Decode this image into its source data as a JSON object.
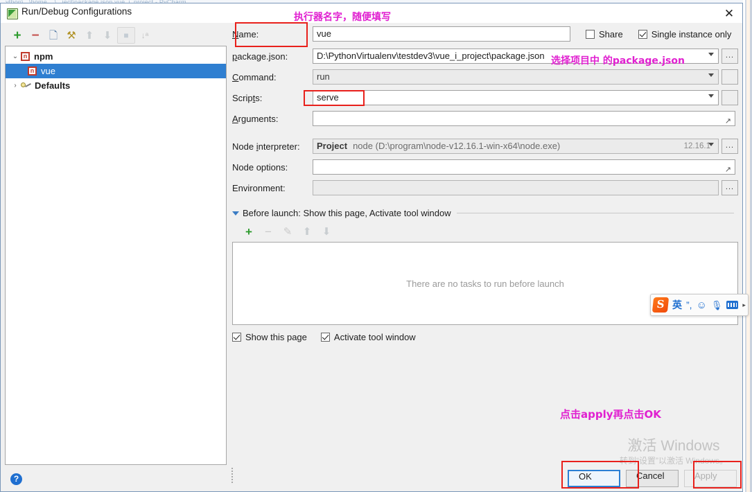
{
  "behind": {
    "top_strip_text": "...ython\\...\\home  ...\\...ject\\package.json  vue_i_project - PyCharm"
  },
  "window": {
    "title": "Run/Debug Configurations",
    "icon": "pycharm-run-config-icon",
    "close_label": "✕"
  },
  "tree_toolbar": [
    {
      "name": "add-configuration-button",
      "glyph": "+",
      "enabled": true
    },
    {
      "name": "remove-configuration-button",
      "glyph": "−",
      "enabled": true
    },
    {
      "name": "copy-configuration-button",
      "glyph": "❐",
      "enabled": true
    },
    {
      "name": "edit-templates-button",
      "glyph": "⚒",
      "enabled": true
    },
    {
      "name": "move-up-button",
      "glyph": "↑",
      "enabled": false
    },
    {
      "name": "move-down-button",
      "glyph": "↓",
      "enabled": false
    },
    {
      "name": "move-into-folder-button",
      "glyph": "■",
      "enabled": false
    },
    {
      "name": "sort-configurations-button",
      "glyph": "↓ᵃ",
      "enabled": false
    }
  ],
  "tree": [
    {
      "name": "tree-node-npm",
      "label": "npm",
      "twisty": "⌄",
      "icon": "npm-icon",
      "icon_text": "n",
      "selected": false,
      "indent": 0
    },
    {
      "name": "tree-node-vue",
      "label": "vue",
      "twisty": "",
      "icon": "npm-icon",
      "icon_text": "n",
      "selected": true,
      "indent": 1
    },
    {
      "name": "tree-node-defaults",
      "label": "Defaults",
      "twisty": "›",
      "icon": "defaults-icon",
      "icon_text": "",
      "selected": false,
      "indent": 0
    }
  ],
  "form": {
    "name_label": "Name:",
    "name_value": "vue",
    "share_label": "Share",
    "share_checked": false,
    "single_instance_label": "Single instance only",
    "single_instance_checked": true,
    "package_json_label": "package.json:",
    "package_json_value": "D:\\PythonVirtualenv\\testdev3\\vue_i_project\\package.json",
    "command_label": "Command:",
    "command_value": "run",
    "scripts_label": "Scripts:",
    "scripts_value": "serve",
    "arguments_label": "Arguments:",
    "arguments_value": "",
    "node_interpreter_label": "Node interpreter:",
    "node_interpreter_scope": "Project",
    "node_interpreter_path": "node (D:\\program\\node-v12.16.1-win-x64\\node.exe)",
    "node_interpreter_version": "12.16.1",
    "node_options_label": "Node options:",
    "node_options_value": "",
    "environment_label": "Environment:",
    "environment_value": "",
    "browse_glyph": "..."
  },
  "before_launch": {
    "header": "Before launch: Show this page, Activate tool window",
    "toolbar": [
      {
        "name": "add-task-button",
        "glyph": "+",
        "enabled": true
      },
      {
        "name": "remove-task-button",
        "glyph": "−",
        "enabled": false
      },
      {
        "name": "edit-task-button",
        "glyph": "✎",
        "enabled": false
      },
      {
        "name": "move-task-up-button",
        "glyph": "↑",
        "enabled": false
      },
      {
        "name": "move-task-down-button",
        "glyph": "↓",
        "enabled": false
      }
    ],
    "empty_text": "There are no tasks to run before launch",
    "show_this_page_label": "Show this page",
    "show_this_page_checked": true,
    "activate_tool_window_label": "Activate tool window",
    "activate_tool_window_checked": true
  },
  "footer": {
    "help_glyph": "?",
    "ok_label": "OK",
    "cancel_label": "Cancel",
    "apply_label": "Apply",
    "apply_enabled": false
  },
  "annotations": {
    "color": "#e020d0",
    "box_color": "#e8201b",
    "name_note": "执行器名字，随便填写",
    "package_note": "选择项目中 的package.json",
    "apply_note": "点击apply再点击OK"
  },
  "watermark": {
    "line1": "激活 Windows",
    "line2": "转到“设置”以激活 Windows。"
  },
  "sogou": {
    "logo": "S",
    "mode": "英",
    "punct": "”,",
    "emoji": "☺",
    "mic": "🎙",
    "keyboard": "keyboard-icon",
    "more": "▸"
  }
}
